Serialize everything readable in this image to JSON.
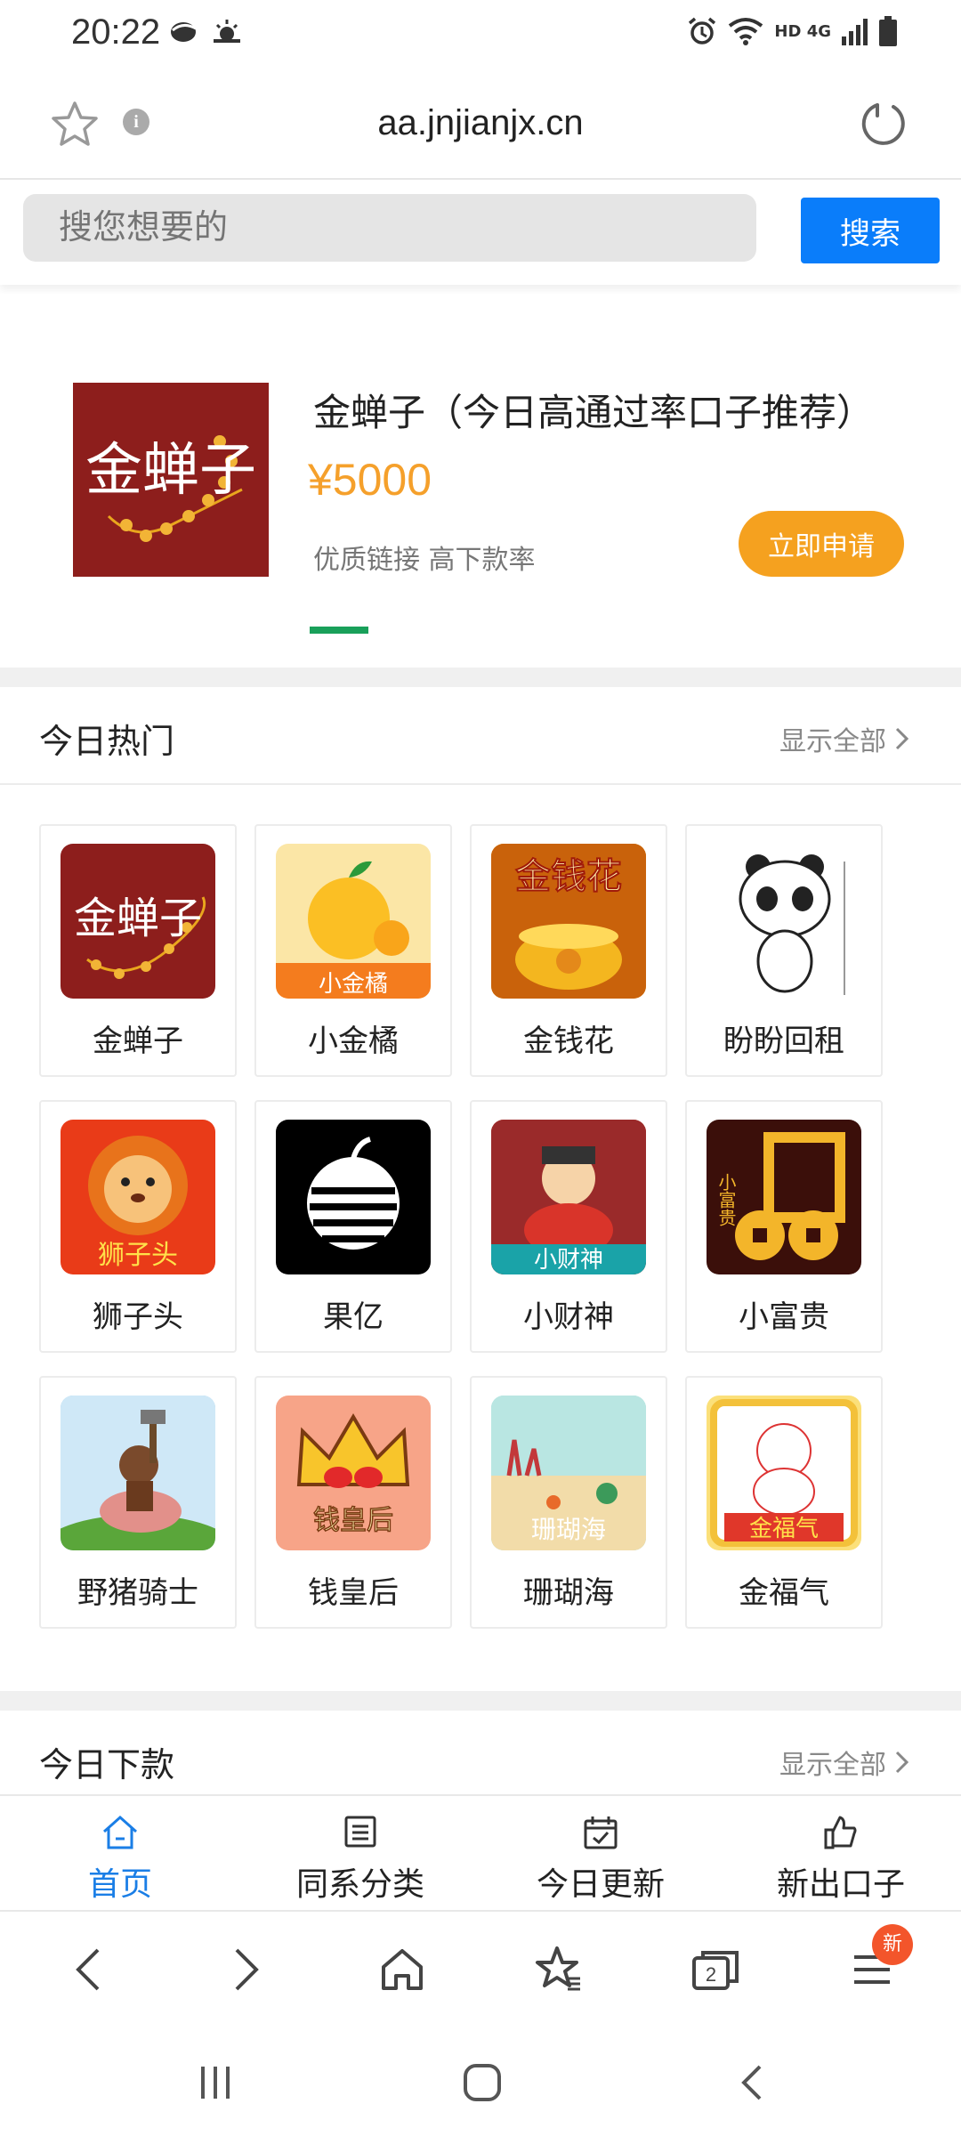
{
  "status_bar": {
    "time": "20:22",
    "network": "HD 4G",
    "icons": [
      "notification-icon",
      "weather-icon",
      "alarm-icon",
      "wifi-icon",
      "signal-icon",
      "battery-icon"
    ]
  },
  "browser": {
    "url": "aa.jnjianjx.cn",
    "tab_count": "2",
    "menu_badge": "新"
  },
  "search": {
    "placeholder": "搜您想要的",
    "button": "搜索"
  },
  "banner": {
    "logo_text": "金蝉子",
    "title": "金蝉子（今日高通过率口子推荐）",
    "amount": "¥5000",
    "description": "优质链接 高下款率",
    "apply_label": "立即申请",
    "accent": "#f5a11f"
  },
  "hot_today": {
    "title": "今日热门",
    "more": "显示全部",
    "apps": [
      {
        "name": "金蝉子",
        "icon_text": "金蝉子",
        "bg": "#8d1e1c"
      },
      {
        "name": "小金橘",
        "icon_text": "小金橘",
        "bg": "#fbe6a6"
      },
      {
        "name": "金钱花",
        "icon_text": "金钱花",
        "bg": "#e9a312"
      },
      {
        "name": "盼盼回租",
        "icon_text": "",
        "bg": "#ffffff"
      },
      {
        "name": "狮子头",
        "icon_text": "狮子头",
        "bg": "#e93b18"
      },
      {
        "name": "果亿",
        "icon_text": "",
        "bg": "#000000"
      },
      {
        "name": "小财神",
        "icon_text": "小财神",
        "bg": "#d34a2a"
      },
      {
        "name": "小富贵",
        "icon_text": "小富贵",
        "bg": "#3b0f0a"
      },
      {
        "name": "野猪骑士",
        "icon_text": "",
        "bg": "#8cc6ea"
      },
      {
        "name": "钱皇后",
        "icon_text": "钱皇后",
        "bg": "#f7a488"
      },
      {
        "name": "珊瑚海",
        "icon_text": "珊瑚海",
        "bg": "#9fd9d6"
      },
      {
        "name": "金福气",
        "icon_text": "金福气",
        "bg": "#fbe07a"
      }
    ]
  },
  "today_loans": {
    "title": "今日下款",
    "more": "显示全部"
  },
  "tabs": [
    {
      "label": "首页",
      "icon": "home-icon",
      "active": true
    },
    {
      "label": "同系分类",
      "icon": "list-icon",
      "active": false
    },
    {
      "label": "今日更新",
      "icon": "calendar-check-icon",
      "active": false
    },
    {
      "label": "新出口子",
      "icon": "thumbs-up-icon",
      "active": false
    }
  ],
  "colors": {
    "primary_blue": "#0a7dfa",
    "active_tab": "#1a7ee6",
    "indicator_green": "#19a05a"
  }
}
